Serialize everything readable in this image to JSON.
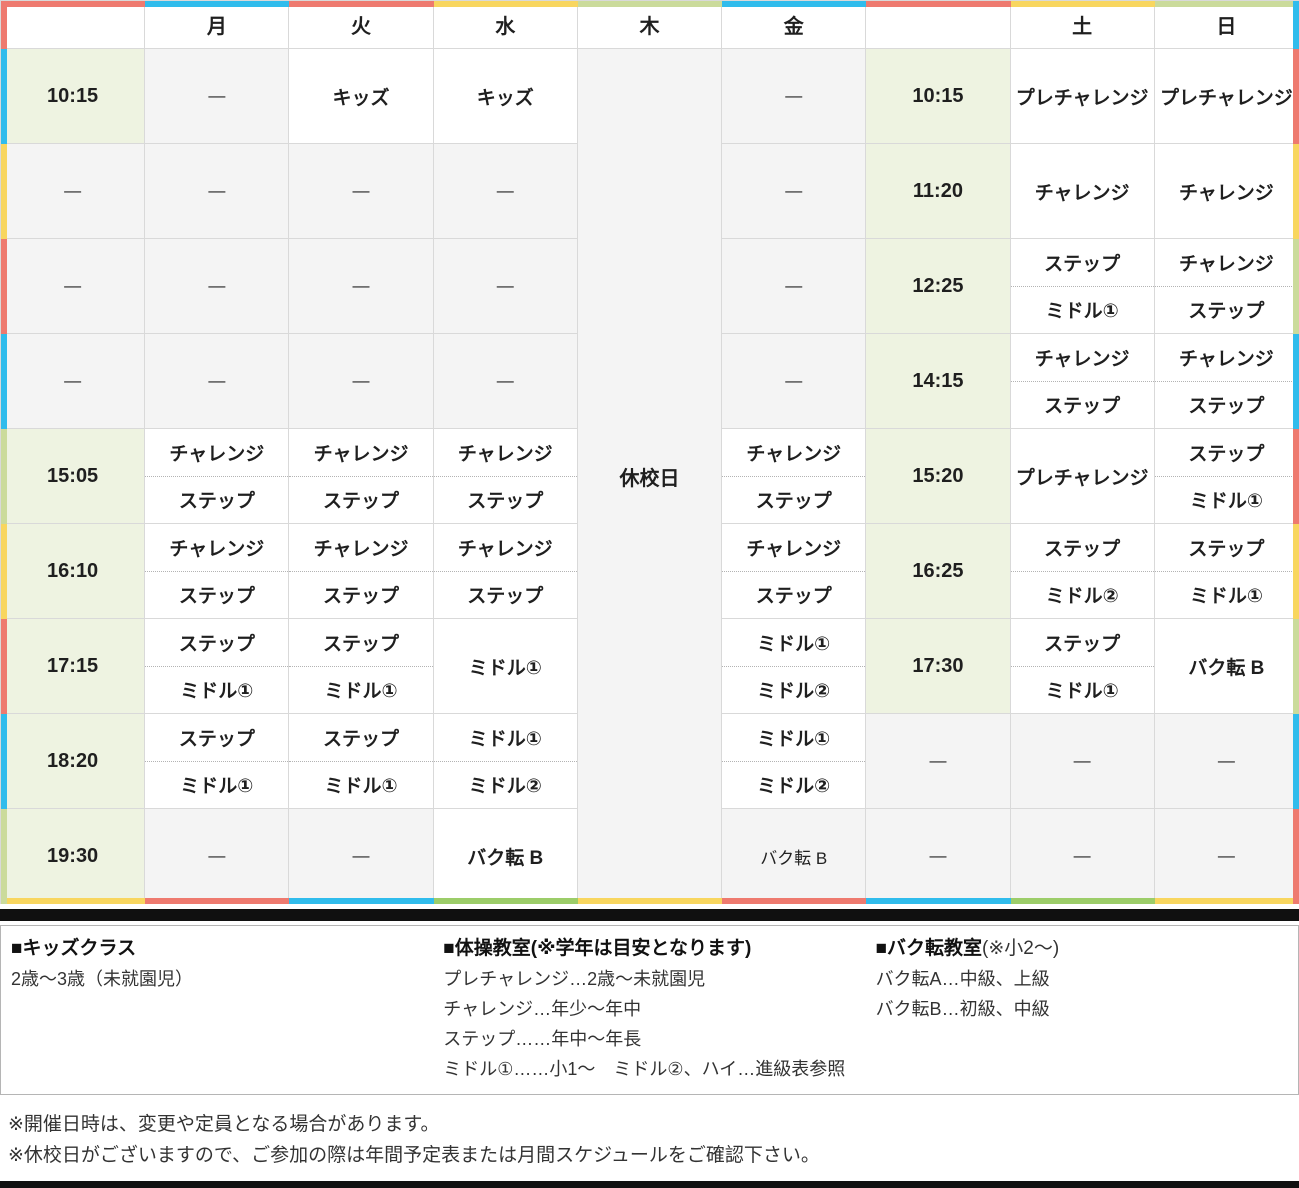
{
  "table": {
    "headers": [
      "",
      "月",
      "火",
      "水",
      "木",
      "金",
      "",
      "土",
      "日"
    ],
    "closed_label": "休校日",
    "cols": {
      "t1": [
        "10:15",
        "—",
        "—",
        "—",
        "15:05",
        "16:10",
        "17:15",
        "18:20",
        "19:30"
      ],
      "mon": [
        "—",
        "—",
        "—",
        "—",
        {
          "top": "チャレンジ",
          "bottom": "ステップ"
        },
        {
          "top": "チャレンジ",
          "bottom": "ステップ"
        },
        {
          "top": "ステップ",
          "bottom": "ミドル①"
        },
        {
          "top": "ステップ",
          "bottom": "ミドル①"
        },
        "—"
      ],
      "tue": [
        "キッズ",
        "—",
        "—",
        "—",
        {
          "top": "チャレンジ",
          "bottom": "ステップ"
        },
        {
          "top": "チャレンジ",
          "bottom": "ステップ"
        },
        {
          "top": "ステップ",
          "bottom": "ミドル①"
        },
        {
          "top": "ステップ",
          "bottom": "ミドル①"
        },
        "—"
      ],
      "wed": [
        "キッズ",
        "—",
        "—",
        "—",
        {
          "top": "チャレンジ",
          "bottom": "ステップ"
        },
        {
          "top": "チャレンジ",
          "bottom": "ステップ"
        },
        "ミドル①",
        {
          "top": "ミドル①",
          "bottom": "ミドル②"
        },
        "バク転 B"
      ],
      "fri": [
        "—",
        "—",
        "—",
        "—",
        {
          "top": "チャレンジ",
          "bottom": "ステップ"
        },
        {
          "top": "チャレンジ",
          "bottom": "ステップ"
        },
        {
          "top": "ミドル①",
          "bottom": "ミドル②"
        },
        {
          "top": "ミドル①",
          "bottom": "ミドル②"
        },
        "バク転 B"
      ],
      "t2": [
        "10:15",
        "11:20",
        "12:25",
        "14:15",
        "15:20",
        "16:25",
        "17:30",
        "—",
        "—"
      ],
      "sat": [
        "プレチャレンジ",
        "チャレンジ",
        {
          "top": "ステップ",
          "bottom": "ミドル①"
        },
        {
          "top": "チャレンジ",
          "bottom": "ステップ"
        },
        "プレチャレンジ",
        {
          "top": "ステップ",
          "bottom": "ミドル②"
        },
        {
          "top": "ステップ",
          "bottom": "ミドル①"
        },
        "—",
        "—"
      ],
      "sun": [
        "プレチャレンジ",
        "チャレンジ",
        {
          "top": "チャレンジ",
          "bottom": "ステップ"
        },
        {
          "top": "チャレンジ",
          "bottom": "ステップ"
        },
        {
          "top": "ステップ",
          "bottom": "ミドル①"
        },
        {
          "top": "ステップ",
          "bottom": "ミドル①"
        },
        "バク転 B",
        "—",
        "—"
      ]
    }
  },
  "accents": {
    "colors": {
      "red": "#ee7a6f",
      "cyan": "#30bcec",
      "yellow": "#f8d65f",
      "green": "#cbdb9b",
      "green2": "#9ccd69"
    },
    "top": [
      "red",
      "cyan",
      "red",
      "yellow",
      "green",
      "cyan",
      "red",
      "yellow",
      "green"
    ],
    "bottom": [
      "yellow",
      "red",
      "cyan",
      "green2",
      "yellow",
      "red",
      "cyan",
      "green2",
      "yellow"
    ],
    "left": [
      "red",
      "cyan",
      "yellow",
      "red",
      "cyan",
      "green",
      "yellow",
      "red",
      "cyan",
      "green"
    ],
    "right": [
      "cyan",
      "red",
      "yellow",
      "green",
      "cyan",
      "red",
      "yellow",
      "green",
      "cyan",
      "red"
    ],
    "time_cell_bg": "#eef3e1",
    "empty_cell_bg": "#f4f4f4"
  },
  "legend": {
    "kids_title": "■キッズクラス",
    "kids_lines": [
      "2歳〜3歳（未就園児）"
    ],
    "gym_title": "■体操教室(※学年は目安となります)",
    "gym_lines": [
      "プレチャレンジ…2歳〜未就園児",
      "チャレンジ…年少〜年中",
      "ステップ……年中〜年長",
      "ミドル①……小1〜　ミドル②、ハイ…進級表参照"
    ],
    "bakuten_title_bold": "■バク転教室",
    "bakuten_title_note": "(※小2〜)",
    "bakuten_lines": [
      "バク転A…中級、上級",
      "バク転B…初級、中級"
    ]
  },
  "notes": [
    "※開催日時は、変更や定員となる場合があります。",
    "※休校日がございますので、ご参加の際は年間予定表または月間スケジュールをご確認下さい。"
  ]
}
